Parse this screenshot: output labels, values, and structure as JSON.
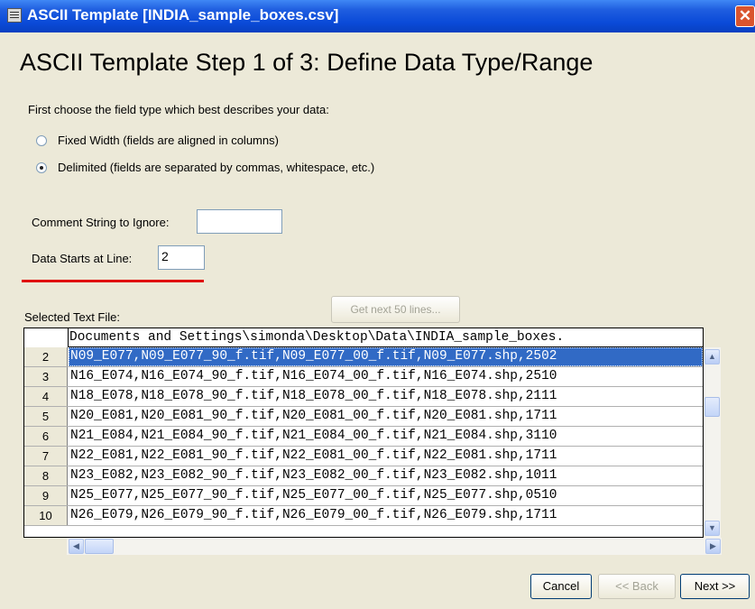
{
  "window": {
    "title": "ASCII Template [INDIA_sample_boxes.csv]",
    "close_glyph": "✕"
  },
  "step": {
    "heading": "ASCII Template Step 1 of 3: Define Data Type/Range"
  },
  "field_type": {
    "prompt": "First choose the field type which best describes your data:",
    "options": [
      {
        "label": "Fixed Width  (fields are aligned in columns)",
        "selected": false
      },
      {
        "label": "Delimited  (fields are separated by commas, whitespace, etc.)",
        "selected": true
      }
    ]
  },
  "comment": {
    "label": "Comment String to Ignore:",
    "value": ""
  },
  "data_start": {
    "label": "Data Starts at Line:",
    "value": "2"
  },
  "text_file": {
    "label": "Selected Text File:",
    "get_next_label": "Get next 50 lines...",
    "path": "Documents and Settings\\simonda\\Desktop\\Data\\INDIA_sample_boxes.",
    "rows": [
      {
        "num": "2",
        "text": "N09_E077,N09_E077_90_f.tif,N09_E077_00_f.tif,N09_E077.shp,2502",
        "selected": true
      },
      {
        "num": "3",
        "text": "N16_E074,N16_E074_90_f.tif,N16_E074_00_f.tif,N16_E074.shp,2510"
      },
      {
        "num": "4",
        "text": "N18_E078,N18_E078_90_f.tif,N18_E078_00_f.tif,N18_E078.shp,2111"
      },
      {
        "num": "5",
        "text": "N20_E081,N20_E081_90_f.tif,N20_E081_00_f.tif,N20_E081.shp,1711"
      },
      {
        "num": "6",
        "text": "N21_E084,N21_E084_90_f.tif,N21_E084_00_f.tif,N21_E084.shp,3110"
      },
      {
        "num": "7",
        "text": "N22_E081,N22_E081_90_f.tif,N22_E081_00_f.tif,N22_E081.shp,1711"
      },
      {
        "num": "8",
        "text": "N23_E082,N23_E082_90_f.tif,N23_E082_00_f.tif,N23_E082.shp,1011"
      },
      {
        "num": "9",
        "text": "N25_E077,N25_E077_90_f.tif,N25_E077_00_f.tif,N25_E077.shp,0510"
      },
      {
        "num": "10",
        "text": "N26_E079,N26_E079_90_f.tif,N26_E079_00_f.tif,N26_E079.shp,1711"
      }
    ]
  },
  "buttons": {
    "cancel": "Cancel",
    "back": "<< Back",
    "next": "Next >>"
  },
  "colors": {
    "title_bar": "#0a4ad8",
    "selection": "#316ac5",
    "annotation_underline": "#e01010"
  }
}
